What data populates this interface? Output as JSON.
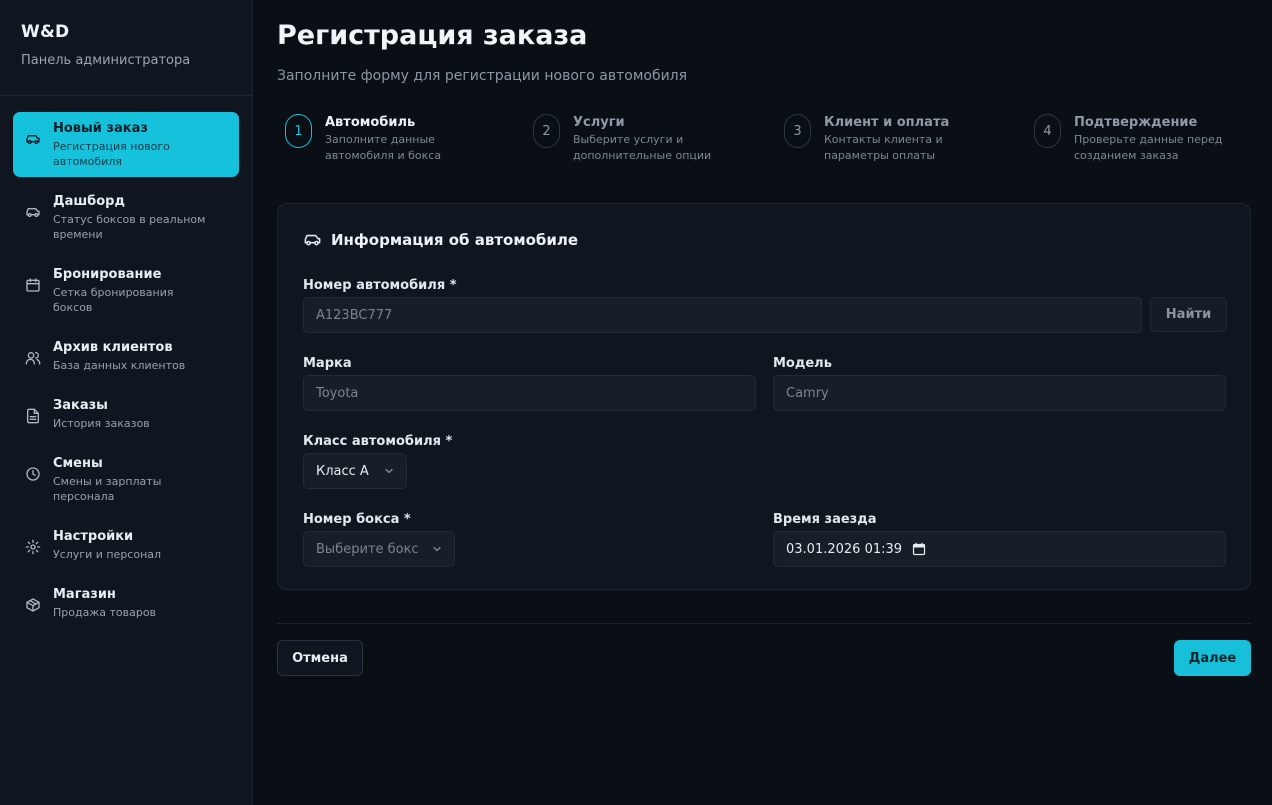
{
  "brand": {
    "title": "W&D",
    "subtitle": "Панель администратора"
  },
  "sidebar": {
    "items": [
      {
        "label": "Новый заказ",
        "desc": "Регистрация нового автомобиля",
        "icon": "car-icon",
        "active": true
      },
      {
        "label": "Дашборд",
        "desc": "Статус боксов в реальном времени",
        "icon": "car-icon"
      },
      {
        "label": "Бронирование",
        "desc": "Сетка бронирования боксов",
        "icon": "calendar-icon"
      },
      {
        "label": "Архив клиентов",
        "desc": "База данных клиентов",
        "icon": "users-icon"
      },
      {
        "label": "Заказы",
        "desc": "История заказов",
        "icon": "document-icon"
      },
      {
        "label": "Смены",
        "desc": "Смены и зарплаты персонала",
        "icon": "clock-icon"
      },
      {
        "label": "Настройки",
        "desc": "Услуги и персонал",
        "icon": "gear-icon"
      },
      {
        "label": "Магазин",
        "desc": "Продажа товаров",
        "icon": "box-icon"
      }
    ]
  },
  "header": {
    "title": "Регистрация заказа",
    "subtitle": "Заполните форму для регистрации нового автомобиля"
  },
  "steps": [
    {
      "num": "1",
      "title": "Автомобиль",
      "desc": "Заполните данные автомобиля и бокса",
      "active": true
    },
    {
      "num": "2",
      "title": "Услуги",
      "desc": "Выберите услуги и дополнительные опции"
    },
    {
      "num": "3",
      "title": "Клиент и оплата",
      "desc": "Контакты клиента и параметры оплаты"
    },
    {
      "num": "4",
      "title": "Подтверждение",
      "desc": "Проверьте данные перед созданием заказа"
    }
  ],
  "form": {
    "title": "Информация об автомобиле",
    "plate": {
      "label": "Номер автомобиля *",
      "placeholder": "A123BC777",
      "find_label": "Найти"
    },
    "make": {
      "label": "Марка",
      "placeholder": "Toyota"
    },
    "model": {
      "label": "Модель",
      "placeholder": "Camry"
    },
    "car_class": {
      "label": "Класс автомобиля *",
      "value": "Класс A"
    },
    "box": {
      "label": "Номер бокса *",
      "placeholder": "Выберите бокс"
    },
    "arrival": {
      "label": "Время заезда",
      "value": "03.01.2026 01:39"
    }
  },
  "footer": {
    "cancel_label": "Отмена",
    "next_label": "Далее"
  },
  "colors": {
    "accent": "#16c1dc",
    "background": "#0a0f16",
    "sidebar": "#0f161f"
  }
}
